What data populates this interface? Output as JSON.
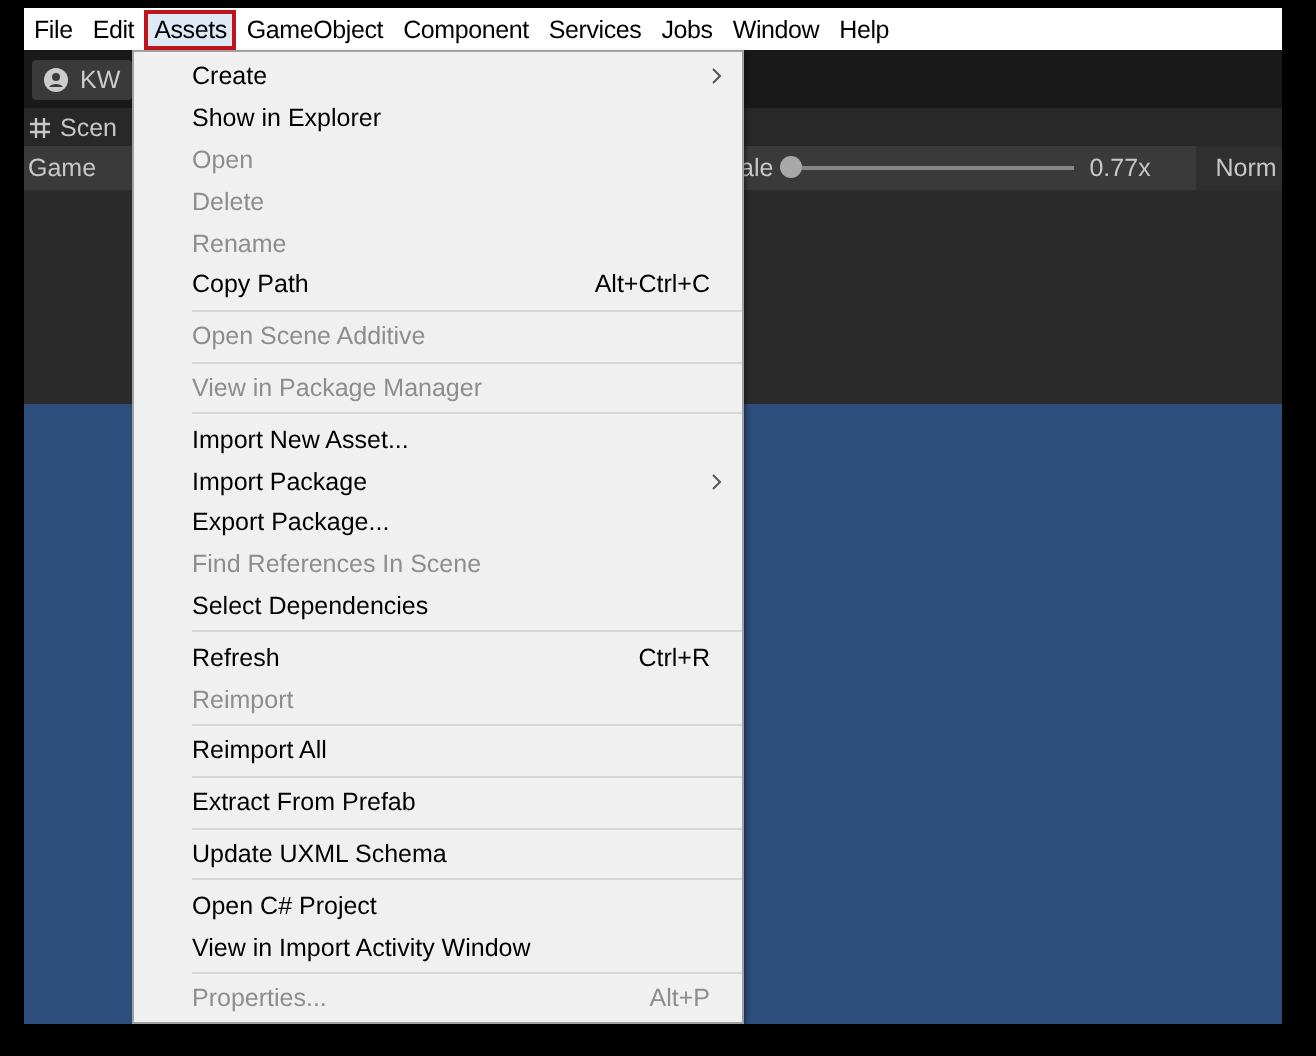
{
  "menubar": [
    {
      "label": "File",
      "selected": false
    },
    {
      "label": "Edit",
      "selected": false
    },
    {
      "label": "Assets",
      "selected": true
    },
    {
      "label": "GameObject",
      "selected": false
    },
    {
      "label": "Component",
      "selected": false
    },
    {
      "label": "Services",
      "selected": false
    },
    {
      "label": "Jobs",
      "selected": false
    },
    {
      "label": "Window",
      "selected": false
    },
    {
      "label": "Help",
      "selected": false
    }
  ],
  "toolbar": {
    "account_button": "KW"
  },
  "scene_tab": {
    "label": "Scen"
  },
  "game_bar": {
    "title": "Game",
    "scale_label": "ale",
    "scale": {
      "level": 0
    },
    "scale_value": "0.77x",
    "aspect": "Norm"
  },
  "assets_menu": {
    "groups": [
      [
        {
          "label": "Create",
          "disabled": false,
          "submenu": true
        },
        {
          "label": "Show in Explorer",
          "disabled": false
        },
        {
          "label": "Open",
          "disabled": true
        },
        {
          "label": "Delete",
          "disabled": true
        },
        {
          "label": "Rename",
          "disabled": true
        },
        {
          "label": "Copy Path",
          "disabled": false,
          "shortcut": "Alt+Ctrl+C"
        }
      ],
      [
        {
          "label": "Open Scene Additive",
          "disabled": true
        }
      ],
      [
        {
          "label": "View in Package Manager",
          "disabled": true
        }
      ],
      [
        {
          "label": "Import New Asset...",
          "disabled": false
        },
        {
          "label": "Import Package",
          "disabled": false,
          "submenu": true
        },
        {
          "label": "Export Package...",
          "disabled": false
        },
        {
          "label": "Find References In Scene",
          "disabled": true
        },
        {
          "label": "Select Dependencies",
          "disabled": false
        }
      ],
      [
        {
          "label": "Refresh",
          "disabled": false,
          "shortcut": "Ctrl+R"
        },
        {
          "label": "Reimport",
          "disabled": true
        }
      ],
      [
        {
          "label": "Reimport All",
          "disabled": false
        }
      ],
      [
        {
          "label": "Extract From Prefab",
          "disabled": false
        }
      ],
      [
        {
          "label": "Update UXML Schema",
          "disabled": false
        }
      ],
      [
        {
          "label": "Open C# Project",
          "disabled": false
        },
        {
          "label": "View in Import Activity Window",
          "disabled": false
        }
      ],
      [
        {
          "label": "Properties...",
          "disabled": true,
          "shortcut": "Alt+P"
        }
      ]
    ]
  }
}
